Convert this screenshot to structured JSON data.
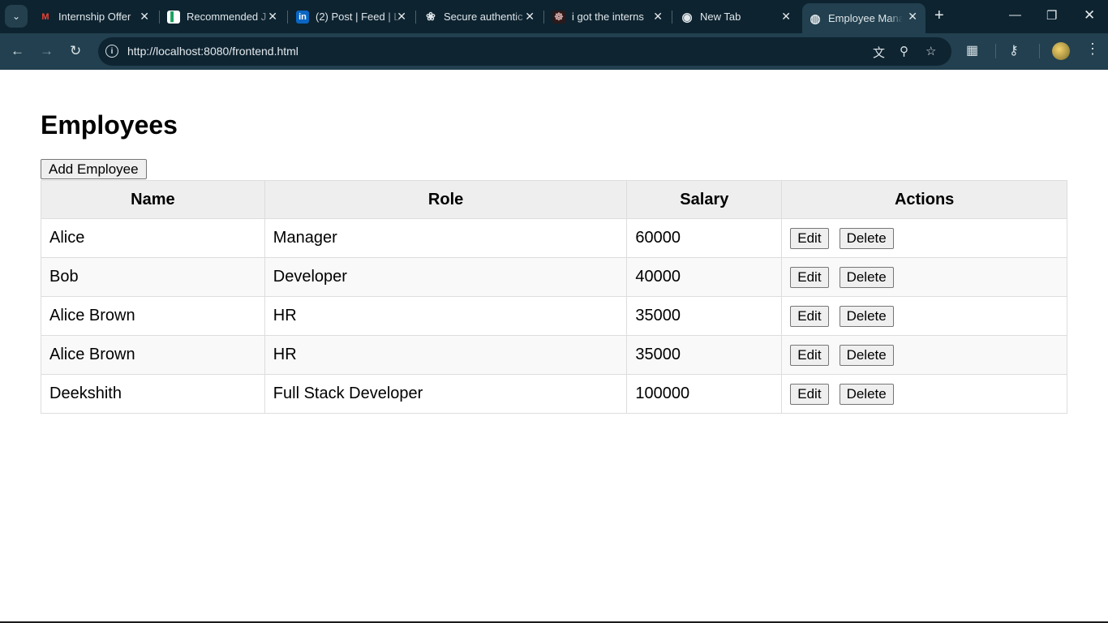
{
  "browser": {
    "tabs": [
      {
        "title": "Internship Offer",
        "icon": "gmail-icon",
        "glyph": "M",
        "color": "#ea4335"
      },
      {
        "title": "Recommended J",
        "icon": "jobs-site-icon",
        "glyph": "▌",
        "color": "#1aa260"
      },
      {
        "title": "(2) Post | Feed | L",
        "icon": "linkedin-icon",
        "glyph": "in",
        "color": "#0a66c2"
      },
      {
        "title": "Secure authentic",
        "icon": "openai-icon",
        "glyph": "❀",
        "color": "#dfe6ea"
      },
      {
        "title": "i got the interns",
        "icon": "profile-favicon-icon",
        "glyph": "☸",
        "color": "#cfa8a8"
      },
      {
        "title": "New Tab",
        "icon": "chrome-icon",
        "glyph": "◉",
        "color": "#dfe6ea"
      },
      {
        "title": "Employee Manag",
        "icon": "globe-icon",
        "glyph": "◍",
        "color": "#dfe6ea",
        "active": true
      }
    ],
    "url": "http://localhost:8080/frontend.html"
  },
  "page": {
    "heading": "Employees",
    "add_button": "Add Employee",
    "table": {
      "headers": [
        "Name",
        "Role",
        "Salary",
        "Actions"
      ],
      "rows": [
        {
          "name": "Alice",
          "role": "Manager",
          "salary": "60000"
        },
        {
          "name": "Bob",
          "role": "Developer",
          "salary": "40000"
        },
        {
          "name": "Alice Brown",
          "role": "HR",
          "salary": "35000"
        },
        {
          "name": "Alice Brown",
          "role": "HR",
          "salary": "35000"
        },
        {
          "name": "Deekshith",
          "role": "Full Stack Developer",
          "salary": "100000"
        }
      ],
      "edit_label": "Edit",
      "delete_label": "Delete"
    }
  }
}
